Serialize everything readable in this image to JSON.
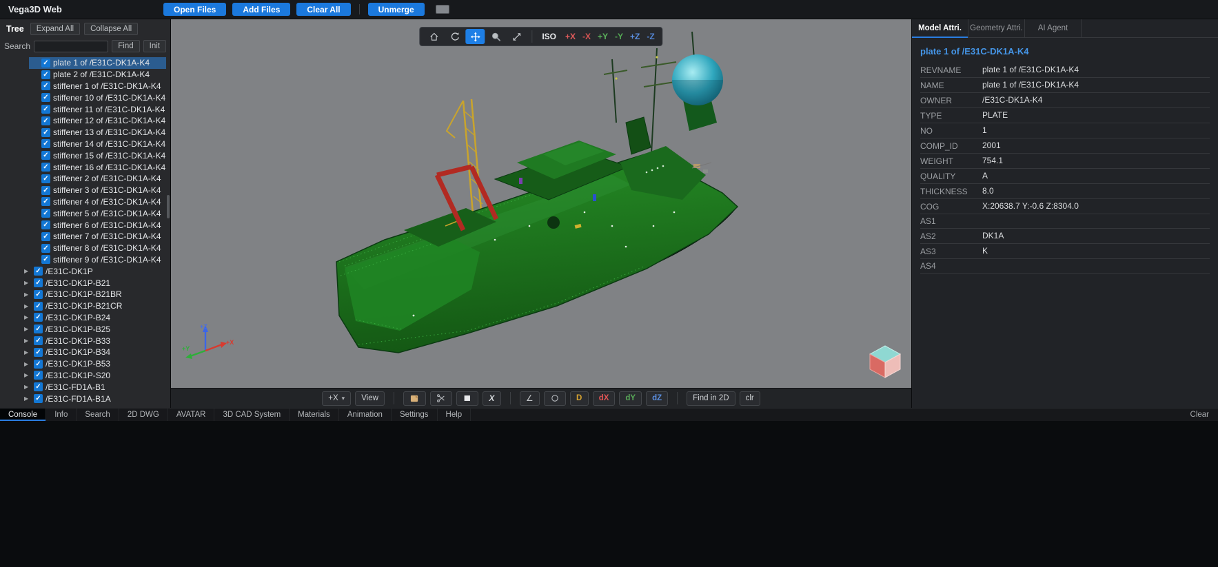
{
  "app": {
    "title": "Vega3D Web"
  },
  "topbar": {
    "open_files": "Open Files",
    "add_files": "Add Files",
    "clear_all": "Clear All",
    "unmerge": "Unmerge"
  },
  "tree_panel": {
    "title": "Tree",
    "expand_all": "Expand All",
    "collapse_all": "Collapse All",
    "search_label": "Search",
    "search_value": "",
    "find_button": "Find",
    "init_button": "Init",
    "items": [
      {
        "label": "plate 1 of /E31C-DK1A-K4",
        "type": "leaf",
        "checked": true,
        "selected": true
      },
      {
        "label": "plate 2 of /E31C-DK1A-K4",
        "type": "leaf",
        "checked": true
      },
      {
        "label": "stiffener 1 of /E31C-DK1A-K4",
        "type": "leaf",
        "checked": true
      },
      {
        "label": "stiffener 10 of /E31C-DK1A-K4",
        "type": "leaf",
        "checked": true
      },
      {
        "label": "stiffener 11 of /E31C-DK1A-K4",
        "type": "leaf",
        "checked": true
      },
      {
        "label": "stiffener 12 of /E31C-DK1A-K4",
        "type": "leaf",
        "checked": true
      },
      {
        "label": "stiffener 13 of /E31C-DK1A-K4",
        "type": "leaf",
        "checked": true
      },
      {
        "label": "stiffener 14 of /E31C-DK1A-K4",
        "type": "leaf",
        "checked": true
      },
      {
        "label": "stiffener 15 of /E31C-DK1A-K4",
        "type": "leaf",
        "checked": true
      },
      {
        "label": "stiffener 16 of /E31C-DK1A-K4",
        "type": "leaf",
        "checked": true
      },
      {
        "label": "stiffener 2 of /E31C-DK1A-K4",
        "type": "leaf",
        "checked": true
      },
      {
        "label": "stiffener 3 of /E31C-DK1A-K4",
        "type": "leaf",
        "checked": true
      },
      {
        "label": "stiffener 4 of /E31C-DK1A-K4",
        "type": "leaf",
        "checked": true
      },
      {
        "label": "stiffener 5 of /E31C-DK1A-K4",
        "type": "leaf",
        "checked": true
      },
      {
        "label": "stiffener 6 of /E31C-DK1A-K4",
        "type": "leaf",
        "checked": true
      },
      {
        "label": "stiffener 7 of /E31C-DK1A-K4",
        "type": "leaf",
        "checked": true
      },
      {
        "label": "stiffener 8 of /E31C-DK1A-K4",
        "type": "leaf",
        "checked": true
      },
      {
        "label": "stiffener 9 of /E31C-DK1A-K4",
        "type": "leaf",
        "checked": true
      },
      {
        "label": "/E31C-DK1P",
        "type": "group",
        "checked": true
      },
      {
        "label": "/E31C-DK1P-B21",
        "type": "group",
        "checked": true
      },
      {
        "label": "/E31C-DK1P-B21BR",
        "type": "group",
        "checked": true
      },
      {
        "label": "/E31C-DK1P-B21CR",
        "type": "group",
        "checked": true
      },
      {
        "label": "/E31C-DK1P-B24",
        "type": "group",
        "checked": true
      },
      {
        "label": "/E31C-DK1P-B25",
        "type": "group",
        "checked": true
      },
      {
        "label": "/E31C-DK1P-B33",
        "type": "group",
        "checked": true
      },
      {
        "label": "/E31C-DK1P-B34",
        "type": "group",
        "checked": true
      },
      {
        "label": "/E31C-DK1P-B53",
        "type": "group",
        "checked": true
      },
      {
        "label": "/E31C-DK1P-S20",
        "type": "group",
        "checked": true
      },
      {
        "label": "/E31C-FD1A-B1",
        "type": "group",
        "checked": true
      },
      {
        "label": "/E31C-FD1A-B1A",
        "type": "group",
        "checked": true
      }
    ]
  },
  "viewport": {
    "view_toolbar": {
      "tools": [
        {
          "icon": "home-icon",
          "active": false
        },
        {
          "icon": "rotate-icon",
          "active": false
        },
        {
          "icon": "pan-icon",
          "active": true
        },
        {
          "icon": "zoom-icon",
          "active": false
        },
        {
          "icon": "fit-icon",
          "active": false
        }
      ],
      "iso_label": "ISO",
      "axis_views": [
        {
          "label": "+X",
          "color": "#e05b5b"
        },
        {
          "label": "-X",
          "color": "#d85454"
        },
        {
          "label": "+Y",
          "color": "#5cb35c"
        },
        {
          "label": "-Y",
          "color": "#54a854"
        },
        {
          "label": "+Z",
          "color": "#5b8fe0"
        },
        {
          "label": "-Z",
          "color": "#5486d6"
        }
      ]
    },
    "bottom_toolbar": {
      "axis_select_value": "+X",
      "view_button": "View",
      "icon_buttons": [
        "clip-plane-icon",
        "section-cut-icon",
        "plane-icon",
        "x-symbol-icon"
      ],
      "measure_buttons": [
        "angle-icon",
        "circle-icon"
      ],
      "delta_buttons": [
        {
          "label": "D",
          "color": "#d9a530"
        },
        {
          "label": "dX",
          "color": "#e05555"
        },
        {
          "label": "dY",
          "color": "#58a858"
        },
        {
          "label": "dZ",
          "color": "#5b8fe0"
        }
      ],
      "find_in_2d": "Find in 2D",
      "clr": "clr"
    },
    "triad": {
      "x_label": "+X",
      "y_label": "+Y",
      "z_label": "+Z"
    }
  },
  "attr_panel": {
    "tabs": [
      {
        "label": "Model Attri.",
        "active": true
      },
      {
        "label": "Geometry Attri.",
        "active": false
      },
      {
        "label": "AI Agent",
        "active": false
      }
    ],
    "header": "plate 1 of /E31C-DK1A-K4",
    "rows": [
      {
        "label": "REVNAME",
        "value": "plate 1 of /E31C-DK1A-K4"
      },
      {
        "label": "NAME",
        "value": "plate 1 of /E31C-DK1A-K4"
      },
      {
        "label": "OWNER",
        "value": "/E31C-DK1A-K4"
      },
      {
        "label": "TYPE",
        "value": "PLATE"
      },
      {
        "label": "NO",
        "value": "1"
      },
      {
        "label": "COMP_ID",
        "value": "2001"
      },
      {
        "label": "WEIGHT",
        "value": "754.1"
      },
      {
        "label": "QUALITY",
        "value": "A"
      },
      {
        "label": "THICKNESS",
        "value": "8.0"
      },
      {
        "label": "COG",
        "value": "X:20638.7 Y:-0.6 Z:8304.0"
      },
      {
        "label": "AS1",
        "value": ""
      },
      {
        "label": "AS2",
        "value": "DK1A"
      },
      {
        "label": "AS3",
        "value": "K"
      },
      {
        "label": "AS4",
        "value": ""
      }
    ]
  },
  "bottom_bar": {
    "tabs": [
      {
        "label": "Console",
        "active": true
      },
      {
        "label": "Info",
        "active": false
      },
      {
        "label": "Search",
        "active": false
      },
      {
        "label": "2D DWG",
        "active": false
      },
      {
        "label": "AVATAR",
        "active": false
      },
      {
        "label": "3D CAD System",
        "active": false
      },
      {
        "label": "Materials",
        "active": false
      },
      {
        "label": "Animation",
        "active": false
      },
      {
        "label": "Settings",
        "active": false
      },
      {
        "label": "Help",
        "active": false
      }
    ],
    "clear_button": "Clear"
  },
  "colors": {
    "accent": "#2a7de1",
    "button_blue": "#1b79dd",
    "selection": "#2b5c8f",
    "checkbox_blue": "#1377d4",
    "viewport_gray": "#808285",
    "ship_green": "#1c6b1c",
    "dome_teal": "#2fa6bd",
    "frame_red": "#b22a22",
    "crane_yellow": "#c9a42c"
  }
}
